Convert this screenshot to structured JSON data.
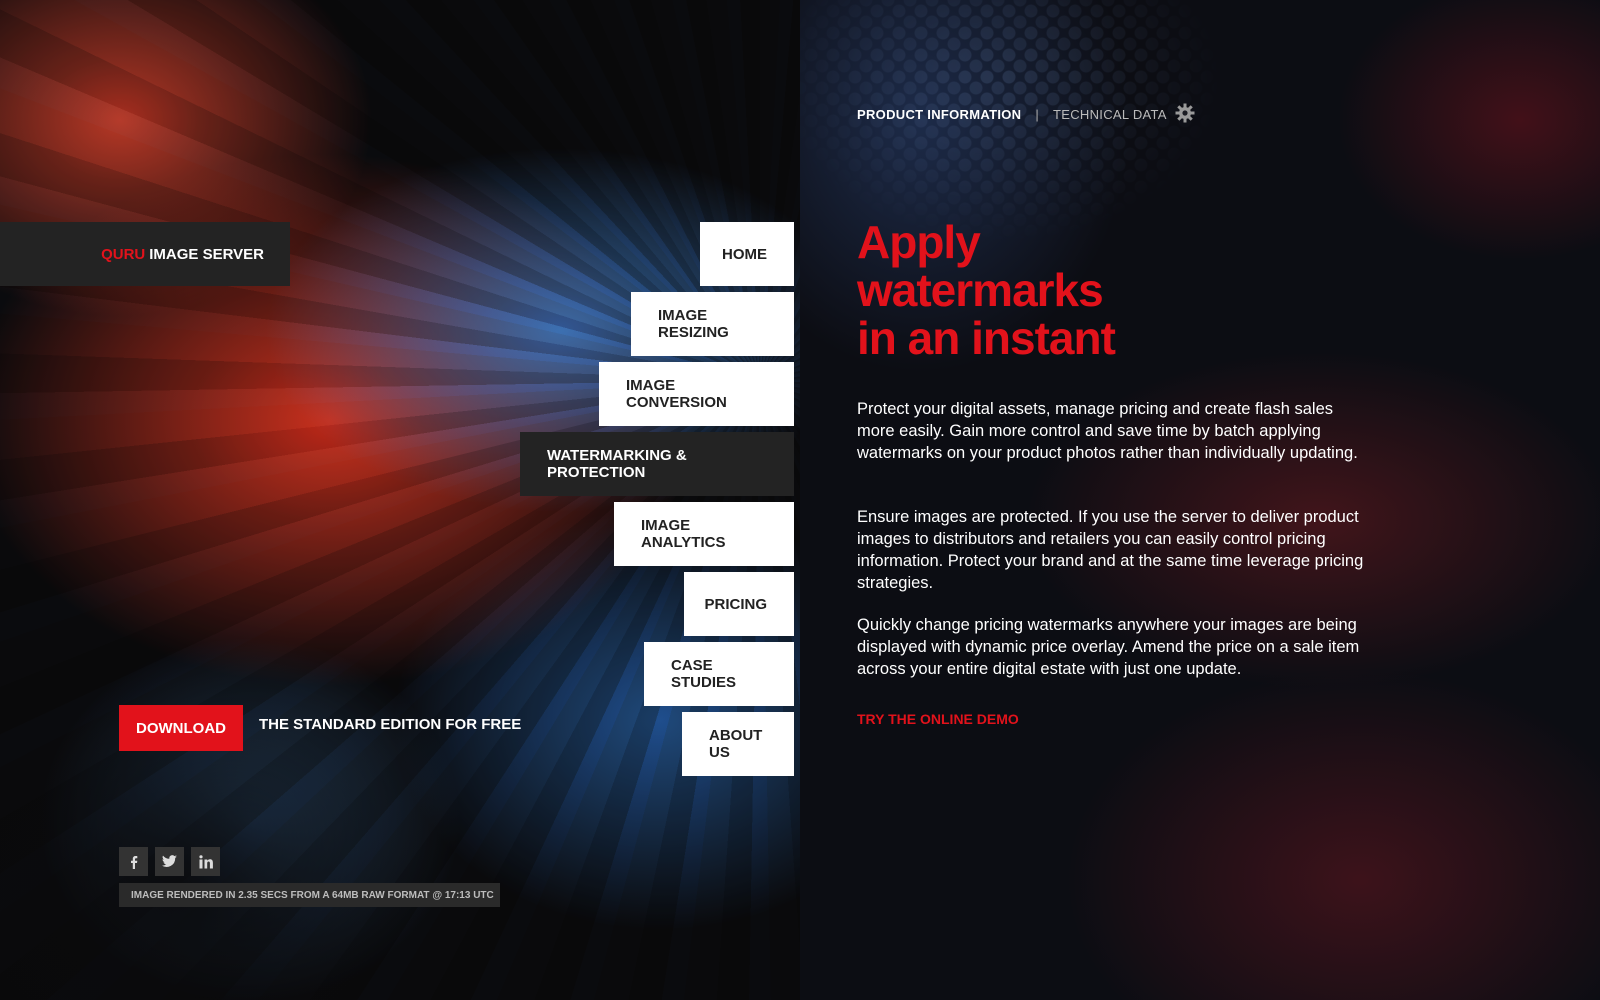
{
  "logo": {
    "brand": "QURU",
    "name": "IMAGE SERVER"
  },
  "nav": {
    "items": [
      {
        "label": "HOME"
      },
      {
        "label": "IMAGE RESIZING"
      },
      {
        "label": "IMAGE CONVERSION"
      },
      {
        "label": "WATERMARKING & PROTECTION",
        "active": true
      },
      {
        "label": "IMAGE ANALYTICS"
      },
      {
        "label": "PRICING"
      },
      {
        "label": "CASE STUDIES"
      },
      {
        "label": "ABOUT US"
      }
    ]
  },
  "download": {
    "button_label": "DOWNLOAD",
    "text": "THE STANDARD EDITION FOR FREE"
  },
  "social": {
    "icons": [
      "facebook-icon",
      "twitter-icon",
      "linkedin-icon"
    ]
  },
  "render_info": "IMAGE RENDERED IN 2.35 SECS FROM A 64MB RAW FORMAT @ 17:13 UTC",
  "toplinks": {
    "product_info": "PRODUCT INFORMATION",
    "separator": "|",
    "technical_data": "TECHNICAL DATA",
    "icon": "gear-icon"
  },
  "headline": {
    "line1": "Apply",
    "line2": "watermarks",
    "line3": "in an instant"
  },
  "paragraphs": [
    "Protect your digital assets, manage pricing and create flash sales more easily. Gain more control and save time by batch applying watermarks on your product photos rather than individually updating.",
    "Ensure images are protected. If you use the server to deliver product images to distributors and retailers you can easily control pricing information. Protect your brand and at the same time leverage pricing strategies.",
    "Quickly change pricing watermarks anywhere your images are being displayed with dynamic price overlay. Amend the price on a sale item across your entire digital estate with just one update."
  ],
  "demo_link": "TRY THE ONLINE DEMO",
  "colors": {
    "accent": "#e2121b",
    "dark_panel": "#232323",
    "white": "#ffffff"
  }
}
